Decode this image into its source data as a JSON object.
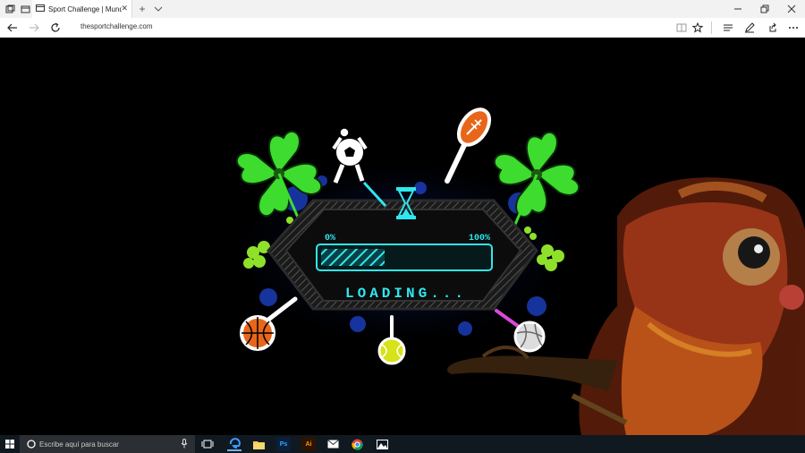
{
  "browser": {
    "tab": {
      "title": "Sport Challenge | Mund"
    },
    "address": {
      "url": "thesportchallenge.com"
    }
  },
  "game": {
    "progress_start_label": "0%",
    "progress_end_label": "100%",
    "loading_text": "LOADING...",
    "progress": 0.38,
    "colors": {
      "accent": "#2ee8ef",
      "clover": "#3ddc2e",
      "frame": "#3a3a3a"
    }
  },
  "taskbar": {
    "search_placeholder": "Escribe aquí para buscar",
    "apps": [
      "task-view-icon",
      "edge-icon",
      "file-explorer-icon",
      "photoshop-icon",
      "illustrator-icon",
      "mail-icon",
      "chrome-icon",
      "photos-icon"
    ],
    "ps_label": "Ps",
    "ai_label": "Ai"
  }
}
